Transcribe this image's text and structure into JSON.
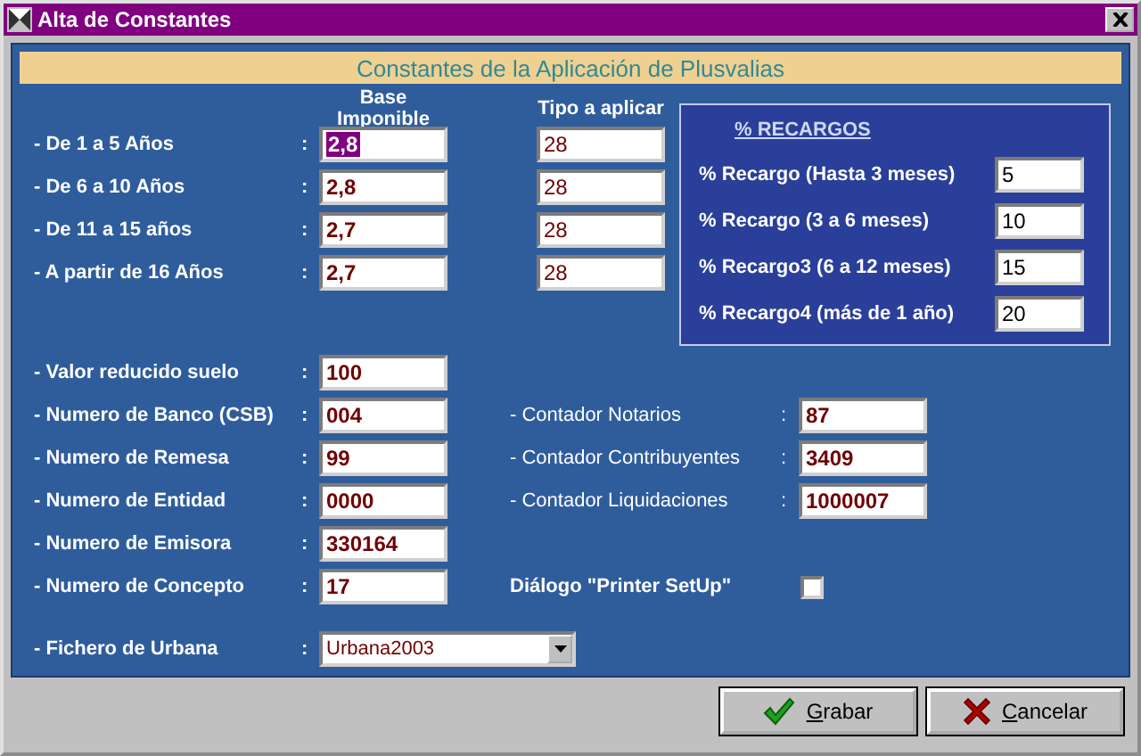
{
  "window": {
    "title": "Alta de Constantes"
  },
  "header": "Constantes de la Aplicación de Plusvalias",
  "columns": [
    "Base Imponible",
    "Tipo a aplicar"
  ],
  "rates": [
    {
      "label": "- De 1 a 5 Años",
      "colon": ":",
      "base": "2,8",
      "selected": true,
      "tipo": "28"
    },
    {
      "label": "- De 6 a 10 Años",
      "colon": ":",
      "base": "2,8",
      "selected": false,
      "tipo": "28"
    },
    {
      "label": "- De 11 a 15 años",
      "colon": ":",
      "base": "2,7",
      "selected": false,
      "tipo": "28"
    },
    {
      "label": "- A partir de 16 Años",
      "colon": ":",
      "base": "2,7",
      "selected": false,
      "tipo": "28"
    }
  ],
  "recargos": {
    "title": "% RECARGOS",
    "items": [
      {
        "label": "% Recargo (Hasta 3 meses)",
        "value": "5"
      },
      {
        "label": "% Recargo (3 a 6 meses)",
        "value": "10"
      },
      {
        "label": "% Recargo3 (6 a 12 meses)",
        "value": "15"
      },
      {
        "label": "% Recargo4 (más de 1 año)",
        "value": "20"
      }
    ]
  },
  "fields": [
    {
      "label": "- Valor reducido suelo",
      "colon": ":",
      "value": "100"
    },
    {
      "label": "- Numero de Banco (CSB)",
      "colon": ":",
      "value": "004"
    },
    {
      "label": "- Numero de Remesa",
      "colon": ":",
      "value": "99"
    },
    {
      "label": "- Numero de Entidad",
      "colon": ":",
      "value": "0000"
    },
    {
      "label": "- Numero de Emisora",
      "colon": ":",
      "value": "330164"
    },
    {
      "label": "- Numero de Concepto",
      "colon": ":",
      "value": "17"
    }
  ],
  "counters": [
    {
      "label": "- Contador Notarios",
      "colon": ":",
      "value": "87"
    },
    {
      "label": "- Contador Contribuyentes",
      "colon": ":",
      "value": "3409"
    },
    {
      "label": "- Contador Liquidaciones",
      "colon": ":",
      "value": "1000007"
    }
  ],
  "printer_dialog": {
    "label": "Diálogo \"Printer SetUp\"",
    "checked": false
  },
  "fichero": {
    "label": "- Fichero de Urbana",
    "colon": ":",
    "value": "Urbana2003"
  },
  "buttons": [
    {
      "label": "Grabar",
      "kind": "ok"
    },
    {
      "label": "Cancelar",
      "kind": "cancel"
    }
  ]
}
